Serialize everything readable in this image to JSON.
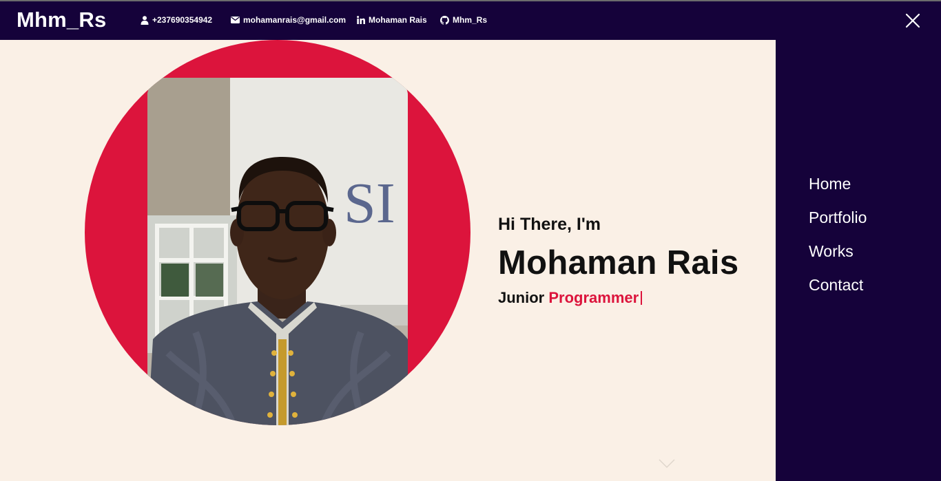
{
  "brand": {
    "logo": "Mhm_Rs"
  },
  "contacts": {
    "phone": "+237690354942",
    "email": "mohamanrais@gmail.com",
    "linkedin": "Mohaman Rais",
    "github": "Mhm_Rs"
  },
  "menu": {
    "items": [
      {
        "label": "Home"
      },
      {
        "label": "Portfolio"
      },
      {
        "label": "Works"
      },
      {
        "label": "Contact"
      }
    ]
  },
  "hero": {
    "greeting": "Hi There, I'm",
    "name": "Mohaman Rais",
    "role_prefix": "Junior",
    "role_highlight": "Programmer"
  },
  "colors": {
    "navy": "#15023a",
    "accent": "#dc143c",
    "cream": "#faf0e6"
  },
  "icons": [
    "user-icon",
    "envelope-icon",
    "linkedin-icon",
    "github-icon",
    "close-icon",
    "chevron-down-icon"
  ]
}
